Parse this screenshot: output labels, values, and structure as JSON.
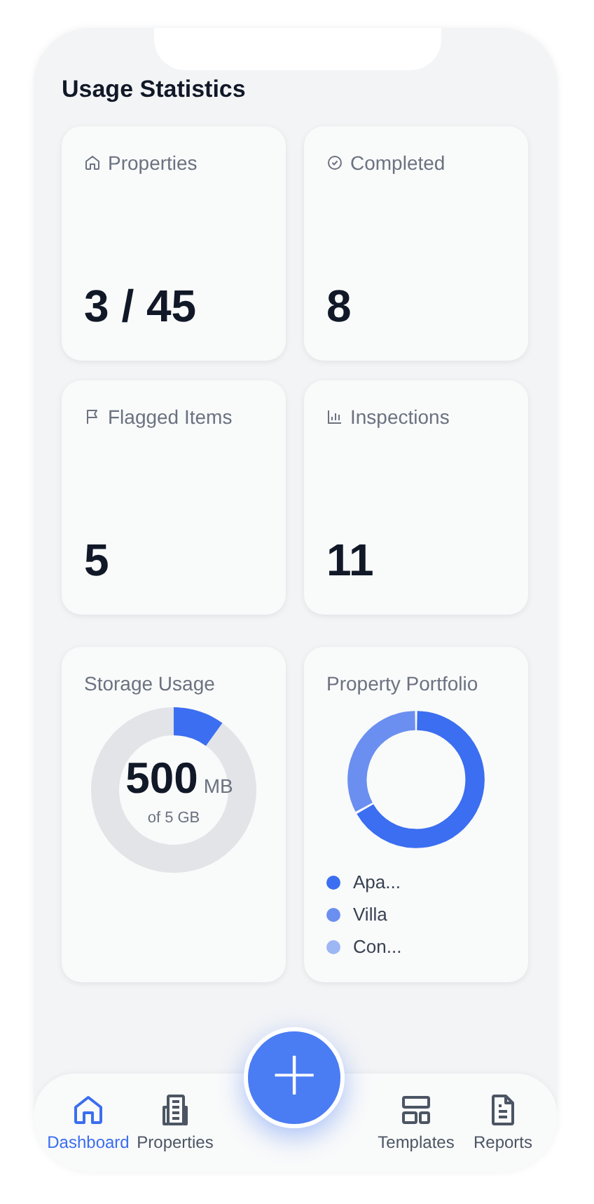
{
  "title": "Usage Statistics",
  "stats": [
    {
      "kind": "house",
      "label": "Properties",
      "value": "3 / 45"
    },
    {
      "kind": "check",
      "label": "Completed",
      "value": "8"
    },
    {
      "kind": "flag",
      "label": "Flagged Items",
      "value": "5"
    },
    {
      "kind": "bars",
      "label": "Inspections",
      "value": "11"
    }
  ],
  "storage": {
    "label": "Storage Usage",
    "value": "500",
    "unit": "MB",
    "caption": "of 5 GB",
    "level": 0.1
  },
  "portfolio": {
    "label": "Property Portfolio",
    "legend": [
      {
        "label": "Apa...",
        "color": "#3b6ef0"
      },
      {
        "label": "Villa",
        "color": "#6b8ff0"
      },
      {
        "label": "Con...",
        "color": "#9db6f4"
      }
    ]
  },
  "nav": [
    {
      "kind": "house",
      "label": "Dashboard",
      "selected": true
    },
    {
      "kind": "building",
      "label": "Properties",
      "selected": false
    },
    {
      "kind": "layout",
      "label": "Templates",
      "selected": false
    },
    {
      "kind": "doc",
      "label": "Reports",
      "selected": false
    }
  ],
  "fab": {
    "symbol": "+"
  }
}
